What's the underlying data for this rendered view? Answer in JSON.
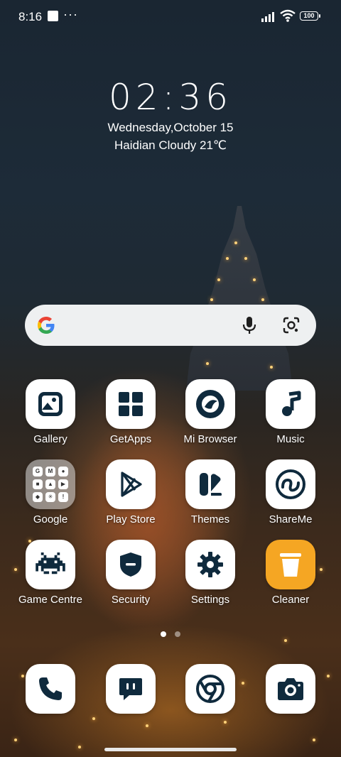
{
  "status_bar": {
    "time": "8:16",
    "dots": "···",
    "battery": "100"
  },
  "lockscreen_widget": {
    "clock": "02:36",
    "date": "Wednesday,October 15",
    "weather": "Haidian Cloudy 21℃"
  },
  "search_bar": {
    "logo_icon": "google-g-icon",
    "mic_icon": "microphone-icon",
    "lens_icon": "google-lens-icon"
  },
  "apps": [
    {
      "label": "Gallery",
      "icon": "gallery-icon"
    },
    {
      "label": "GetApps",
      "icon": "getapps-icon"
    },
    {
      "label": "Mi Browser",
      "icon": "mi-browser-icon"
    },
    {
      "label": "Music",
      "icon": "music-note-icon"
    },
    {
      "label": "Google",
      "icon": "folder-icon",
      "folder_items": [
        "G",
        "M",
        "●",
        "■",
        "▲",
        "▶",
        "◆",
        "✳",
        "!"
      ]
    },
    {
      "label": "Play Store",
      "icon": "play-store-icon"
    },
    {
      "label": "Themes",
      "icon": "themes-icon"
    },
    {
      "label": "ShareMe",
      "icon": "shareme-icon"
    },
    {
      "label": "Game Centre",
      "icon": "game-invader-icon"
    },
    {
      "label": "Security",
      "icon": "shield-icon"
    },
    {
      "label": "Settings",
      "icon": "gear-icon"
    },
    {
      "label": "Cleaner",
      "icon": "trash-icon"
    }
  ],
  "dock": [
    {
      "icon": "phone-icon"
    },
    {
      "icon": "messages-icon"
    },
    {
      "icon": "chrome-icon"
    },
    {
      "icon": "camera-icon"
    }
  ],
  "page_indicator": {
    "pages": 2,
    "current": 1
  },
  "colors": {
    "icon_dark": "#0f2a3d",
    "tile_bg": "#ffffff",
    "cleaner_bg": "#f5a623",
    "search_bg": "#eef0f1"
  }
}
